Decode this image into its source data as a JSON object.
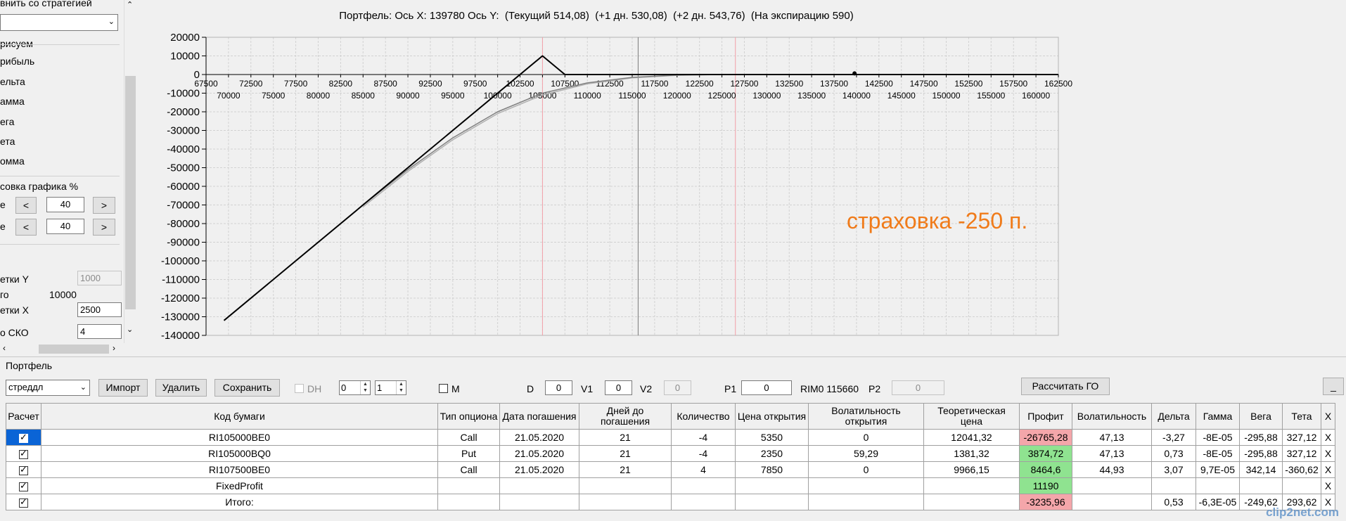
{
  "left_panel": {
    "strategy_label": "внить со стратегией",
    "draw_label": "рисуем",
    "items": [
      "рибыль",
      "ельта",
      "амма",
      "ега",
      "ета",
      "омма"
    ],
    "chart_setting_title": "совка графика %",
    "row1_label": "е",
    "row1_value": "40",
    "row2_label": "е",
    "row2_value": "40",
    "prev_button": "<",
    "next_button": ">",
    "grid_y_label": "етки Y",
    "grid_y_value": "1000",
    "total_label": "го",
    "total_value": "10000",
    "grid_x_label": "етки X",
    "grid_x_value": "2500",
    "sko_label": "о СКО",
    "sko_value": "4"
  },
  "chart": {
    "title": "Портфель: Ось X: 139780 Ось Y:  (Текущий 514,08)  (+1 дн. 530,08)  (+2 дн. 543,76)  (На экспирацию 590)",
    "annotation": "страховка -250 п."
  },
  "chart_data": {
    "type": "line",
    "title": "Портфель: Ось X: 139780 Ось Y:  (Текущий 514,08)  (+1 дн. 530,08)  (+2 дн. 543,76)  (На экспирацию 590)",
    "xlim": [
      67500,
      162500
    ],
    "ylim": [
      -140000,
      20000
    ],
    "x_ticks_top": [
      "67500",
      "72500",
      "77500",
      "82500",
      "87500",
      "92500",
      "97500",
      "102500",
      "107500",
      "112500",
      "117500",
      "122500",
      "127500",
      "132500",
      "137500",
      "142500",
      "147500",
      "152500",
      "157500",
      "162500"
    ],
    "x_ticks_bottom": [
      "70000",
      "75000",
      "80000",
      "85000",
      "90000",
      "95000",
      "100000",
      "105000",
      "110000",
      "115000",
      "120000",
      "125000",
      "130000",
      "135000",
      "140000",
      "145000",
      "150000",
      "155000",
      "160000"
    ],
    "y_ticks": [
      "20000",
      "10000",
      "0",
      "-10000",
      "-20000",
      "-30000",
      "-40000",
      "-50000",
      "-60000",
      "-70000",
      "-80000",
      "-90000",
      "-100000",
      "-110000",
      "-120000",
      "-130000",
      "-140000"
    ],
    "series": [
      {
        "color": "#000000",
        "x": [
          69500,
          105000,
          107500,
          162500
        ],
        "y": [
          -132000,
          10000,
          0,
          0
        ]
      },
      {
        "color": "#808080",
        "x": [
          85000,
          90000,
          95000,
          100000,
          105000,
          110000,
          115000,
          120000,
          125000,
          130000,
          162500
        ],
        "y": [
          -70000,
          -51000,
          -34000,
          -20000,
          -10000,
          -4500,
          -1500,
          -300,
          0,
          0,
          0
        ]
      },
      {
        "color": "#b0b0b0",
        "x": [
          85000,
          90000,
          95000,
          100000,
          105000,
          110000,
          115000,
          120000,
          125000,
          130000,
          162500
        ],
        "y": [
          -71000,
          -52000,
          -35000,
          -21000,
          -11000,
          -5000,
          -1800,
          -400,
          0,
          0,
          0
        ]
      }
    ],
    "vertical_lines": [
      {
        "x": 105000,
        "color": "#f3a0a8"
      },
      {
        "x": 115660,
        "color": "#7a7a7a"
      },
      {
        "x": 126500,
        "color": "#f3a0a8"
      }
    ],
    "marker": {
      "x": 139780,
      "y": 590
    }
  },
  "portfolio": {
    "group_label": "Портфель",
    "strategy_select": "стреддл",
    "import_button": "Импорт",
    "delete_button": "Удалить",
    "save_button": "Сохранить",
    "dh_label": "DH",
    "spin1": "0",
    "spin2": "1",
    "m_label": "M",
    "d_label": "D",
    "d_value": "0",
    "v1_label": "V1",
    "v1_value": "0",
    "v2_label": "V2",
    "v2_value": "0",
    "p1_label": "P1",
    "p1_value": "0",
    "rim_label": "RIM0 115660",
    "p2_label": "P2",
    "p2_value": "0",
    "calc_go_button": "Рассчитать ГО",
    "min_button": "_"
  },
  "table": {
    "headers": [
      "Расчет",
      "Код бумаги",
      "Тип опциона",
      "Дата погашения",
      "Дней до погашения",
      "Количество",
      "Цена открытия",
      "Волатильность открытия",
      "Теоретическая цена",
      "Профит",
      "Волатильность",
      "Дельта",
      "Гамма",
      "Вега",
      "Тета",
      "X"
    ],
    "rows": [
      {
        "checked": true,
        "code": "RI105000BE0",
        "type": "Call",
        "date": "21.05.2020",
        "days": "21",
        "qty": "-4",
        "price": "5350",
        "vol_open": "0",
        "theor": "12041,32",
        "profit": "-26765,28",
        "profit_state": "neg",
        "vol": "47,13",
        "delta": "-3,27",
        "gamma": "-8E-05",
        "vega": "-295,88",
        "theta": "327,12",
        "x": "X"
      },
      {
        "checked": true,
        "code": "RI105000BQ0",
        "type": "Put",
        "date": "21.05.2020",
        "days": "21",
        "qty": "-4",
        "price": "2350",
        "vol_open": "59,29",
        "theor": "1381,32",
        "profit": "3874,72",
        "profit_state": "pos",
        "vol": "47,13",
        "delta": "0,73",
        "gamma": "-8E-05",
        "vega": "-295,88",
        "theta": "327,12",
        "x": "X"
      },
      {
        "checked": true,
        "code": "RI107500BE0",
        "type": "Call",
        "date": "21.05.2020",
        "days": "21",
        "qty": "4",
        "price": "7850",
        "vol_open": "0",
        "theor": "9966,15",
        "profit": "8464,6",
        "profit_state": "pos",
        "vol": "44,93",
        "delta": "3,07",
        "gamma": "9,7E-05",
        "vega": "342,14",
        "theta": "-360,62",
        "x": "X"
      },
      {
        "checked": true,
        "code": "FixedProfit",
        "type": "",
        "date": "",
        "days": "",
        "qty": "",
        "price": "",
        "vol_open": "",
        "theor": "",
        "profit": "11190",
        "profit_state": "pos",
        "vol": "",
        "delta": "",
        "gamma": "",
        "vega": "",
        "theta": "",
        "x": "X"
      },
      {
        "checked": true,
        "code": "Итого:",
        "type": "",
        "date": "",
        "days": "",
        "qty": "",
        "price": "",
        "vol_open": "",
        "theor": "",
        "profit": "-3235,96",
        "profit_state": "neg",
        "vol": "",
        "delta": "0,53",
        "gamma": "-6,3E-05",
        "vega": "-249,62",
        "theta": "293,62",
        "x": "X"
      }
    ]
  },
  "watermark": "clip2net.com"
}
